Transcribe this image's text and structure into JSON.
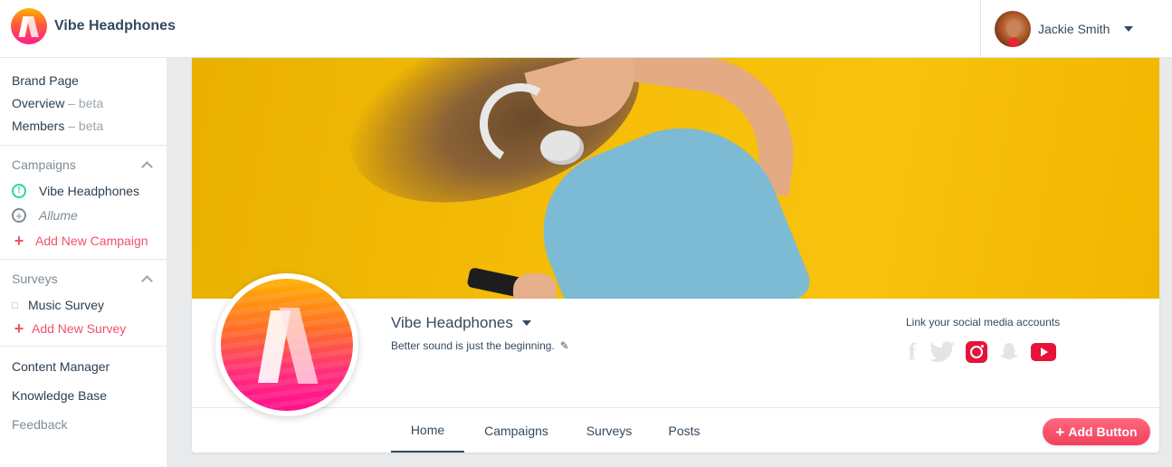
{
  "brand": {
    "name": "Vibe Headphones",
    "logo_icon": "vibe-logo"
  },
  "user": {
    "name": "Jackie Smith"
  },
  "sidebar": {
    "links": [
      {
        "label": "Brand Page",
        "suffix": ""
      },
      {
        "label": "Overview",
        "suffix": " – beta"
      },
      {
        "label": "Members",
        "suffix": " – beta"
      }
    ],
    "campaigns": {
      "title": "Campaigns",
      "items": [
        {
          "label": "Vibe Headphones",
          "icon": "alert-circle-icon",
          "color": "#2c3e50"
        },
        {
          "label": "Allume",
          "icon": "plus-circle-icon",
          "color": "#7f8b96"
        },
        {
          "label": "Add New Campaign",
          "icon": "plus-icon",
          "color": "#f5506a"
        }
      ]
    },
    "surveys": {
      "title": "Surveys",
      "items": [
        {
          "label": "Music Survey",
          "icon": "square-icon"
        },
        {
          "label": "Add New Survey",
          "icon": "plus-icon"
        }
      ]
    },
    "bottom_links": [
      "Content Manager",
      "Knowledge Base",
      "Feedback"
    ]
  },
  "profile": {
    "name": "Vibe Headphones",
    "tagline": "Better sound is just the beginning.",
    "social_label": "Link your social media accounts",
    "social_icons": [
      "facebook-icon",
      "twitter-icon",
      "instagram-icon",
      "snapchat-icon",
      "youtube-icon"
    ]
  },
  "tabs": [
    "Home",
    "Campaigns",
    "Surveys",
    "Posts"
  ],
  "active_tab": "Home",
  "add_button": "Add Button",
  "colors": {
    "accent": "#f5506a",
    "success": "#2bd4a4",
    "cover": "#f5bd08",
    "social_active": "#e5143b"
  }
}
